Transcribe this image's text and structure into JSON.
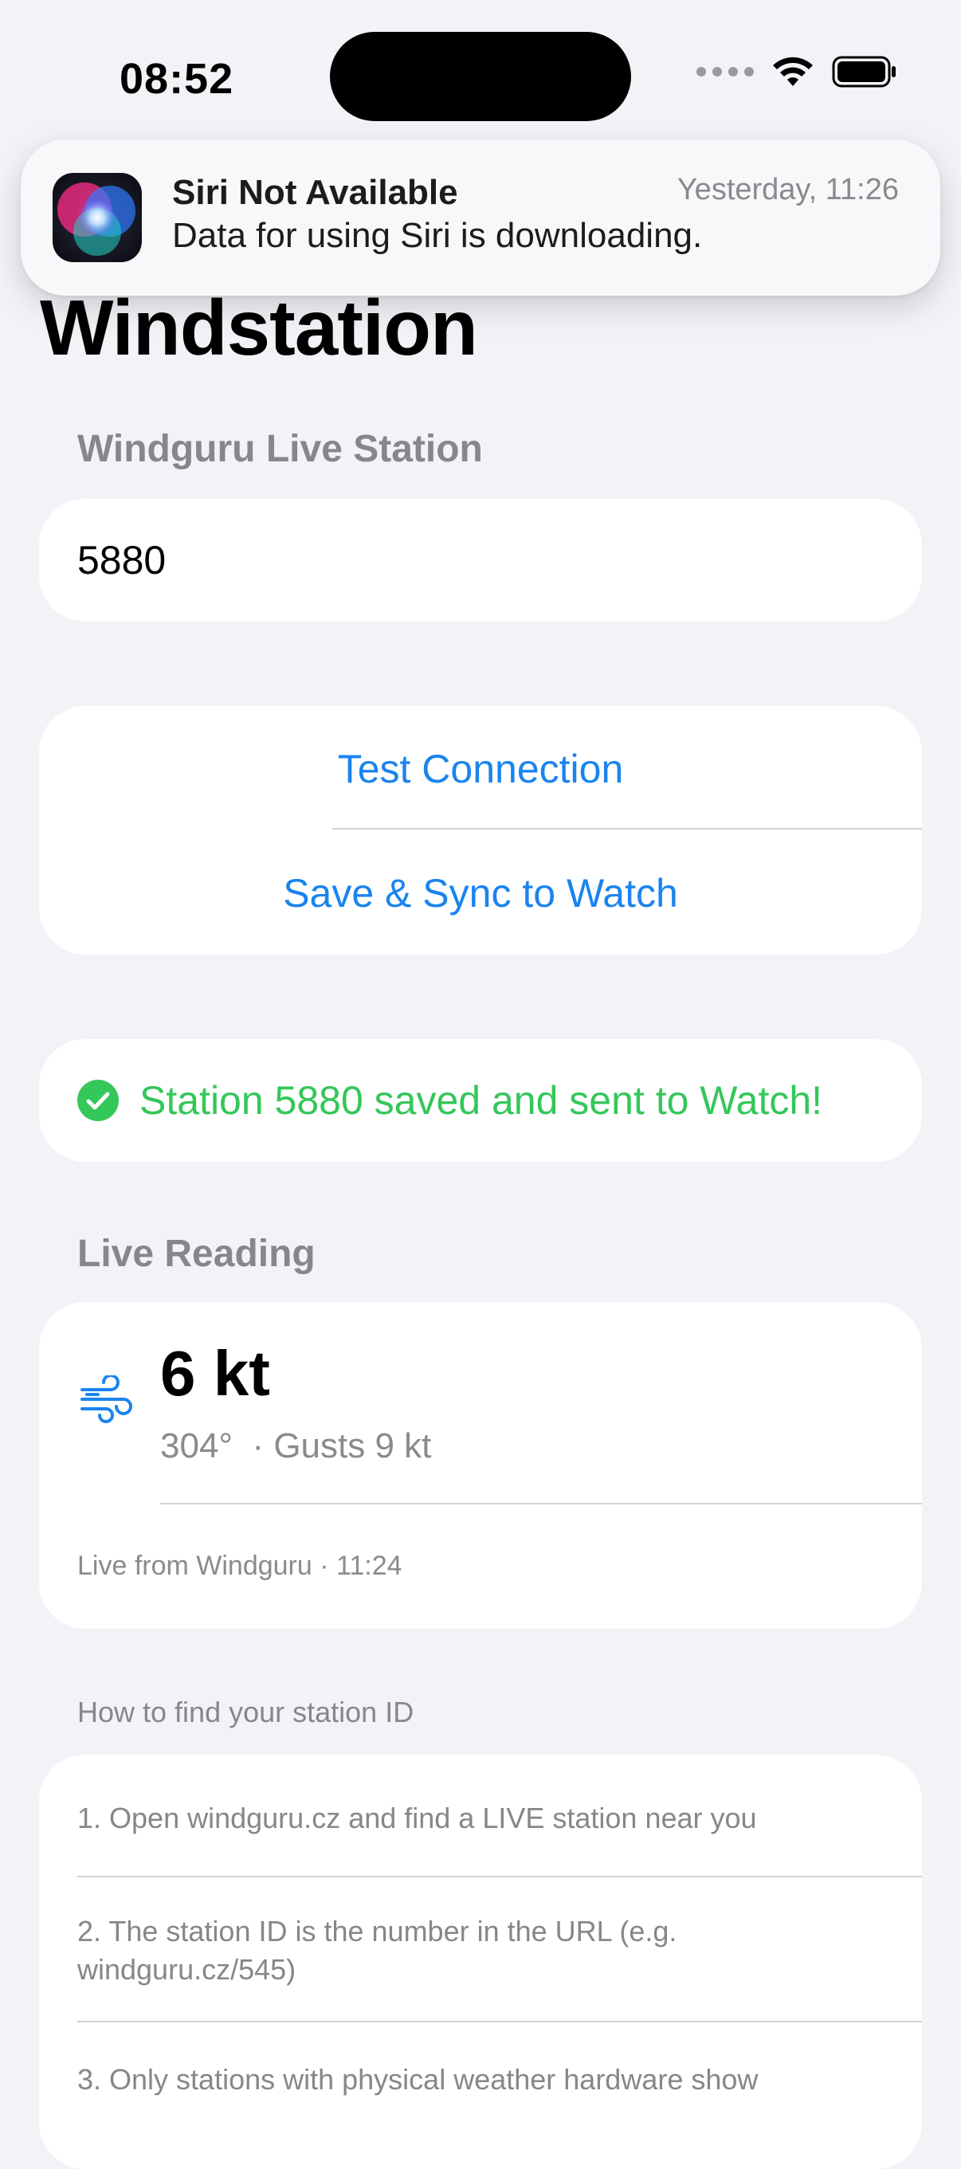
{
  "status_bar": {
    "time": "08:52"
  },
  "notification": {
    "title": "Siri Not Available",
    "time": "Yesterday, 11:26",
    "body": "Data for using Siri is downloading."
  },
  "page": {
    "title": "Windstation"
  },
  "station_section": {
    "header": "Windguru Live Station",
    "field_value": "5880"
  },
  "actions": {
    "test_connection": "Test Connection",
    "save_sync": "Save & Sync to Watch"
  },
  "status": {
    "message": "Station 5880 saved and sent to Watch!",
    "color": "#34c759"
  },
  "live_reading": {
    "header": "Live Reading",
    "speed": "6 kt",
    "detail": "304°  · Gusts 9 kt",
    "source": "Live from Windguru · 11:24"
  },
  "howto": {
    "header": "How to find your station ID",
    "steps": [
      "1. Open windguru.cz and find a LIVE station near you",
      "2. The station ID is the number in the URL (e.g. windguru.cz/545)",
      "3. Only stations with physical weather hardware show"
    ]
  },
  "colors": {
    "accent": "#1a84ef",
    "background": "#F2F2F7",
    "secondary_text": "#86868b"
  },
  "icons": {
    "app": "siri-icon",
    "wind": "wind-icon",
    "success": "checkmark-circle-icon",
    "wifi": "wifi-icon",
    "battery": "battery-icon"
  }
}
